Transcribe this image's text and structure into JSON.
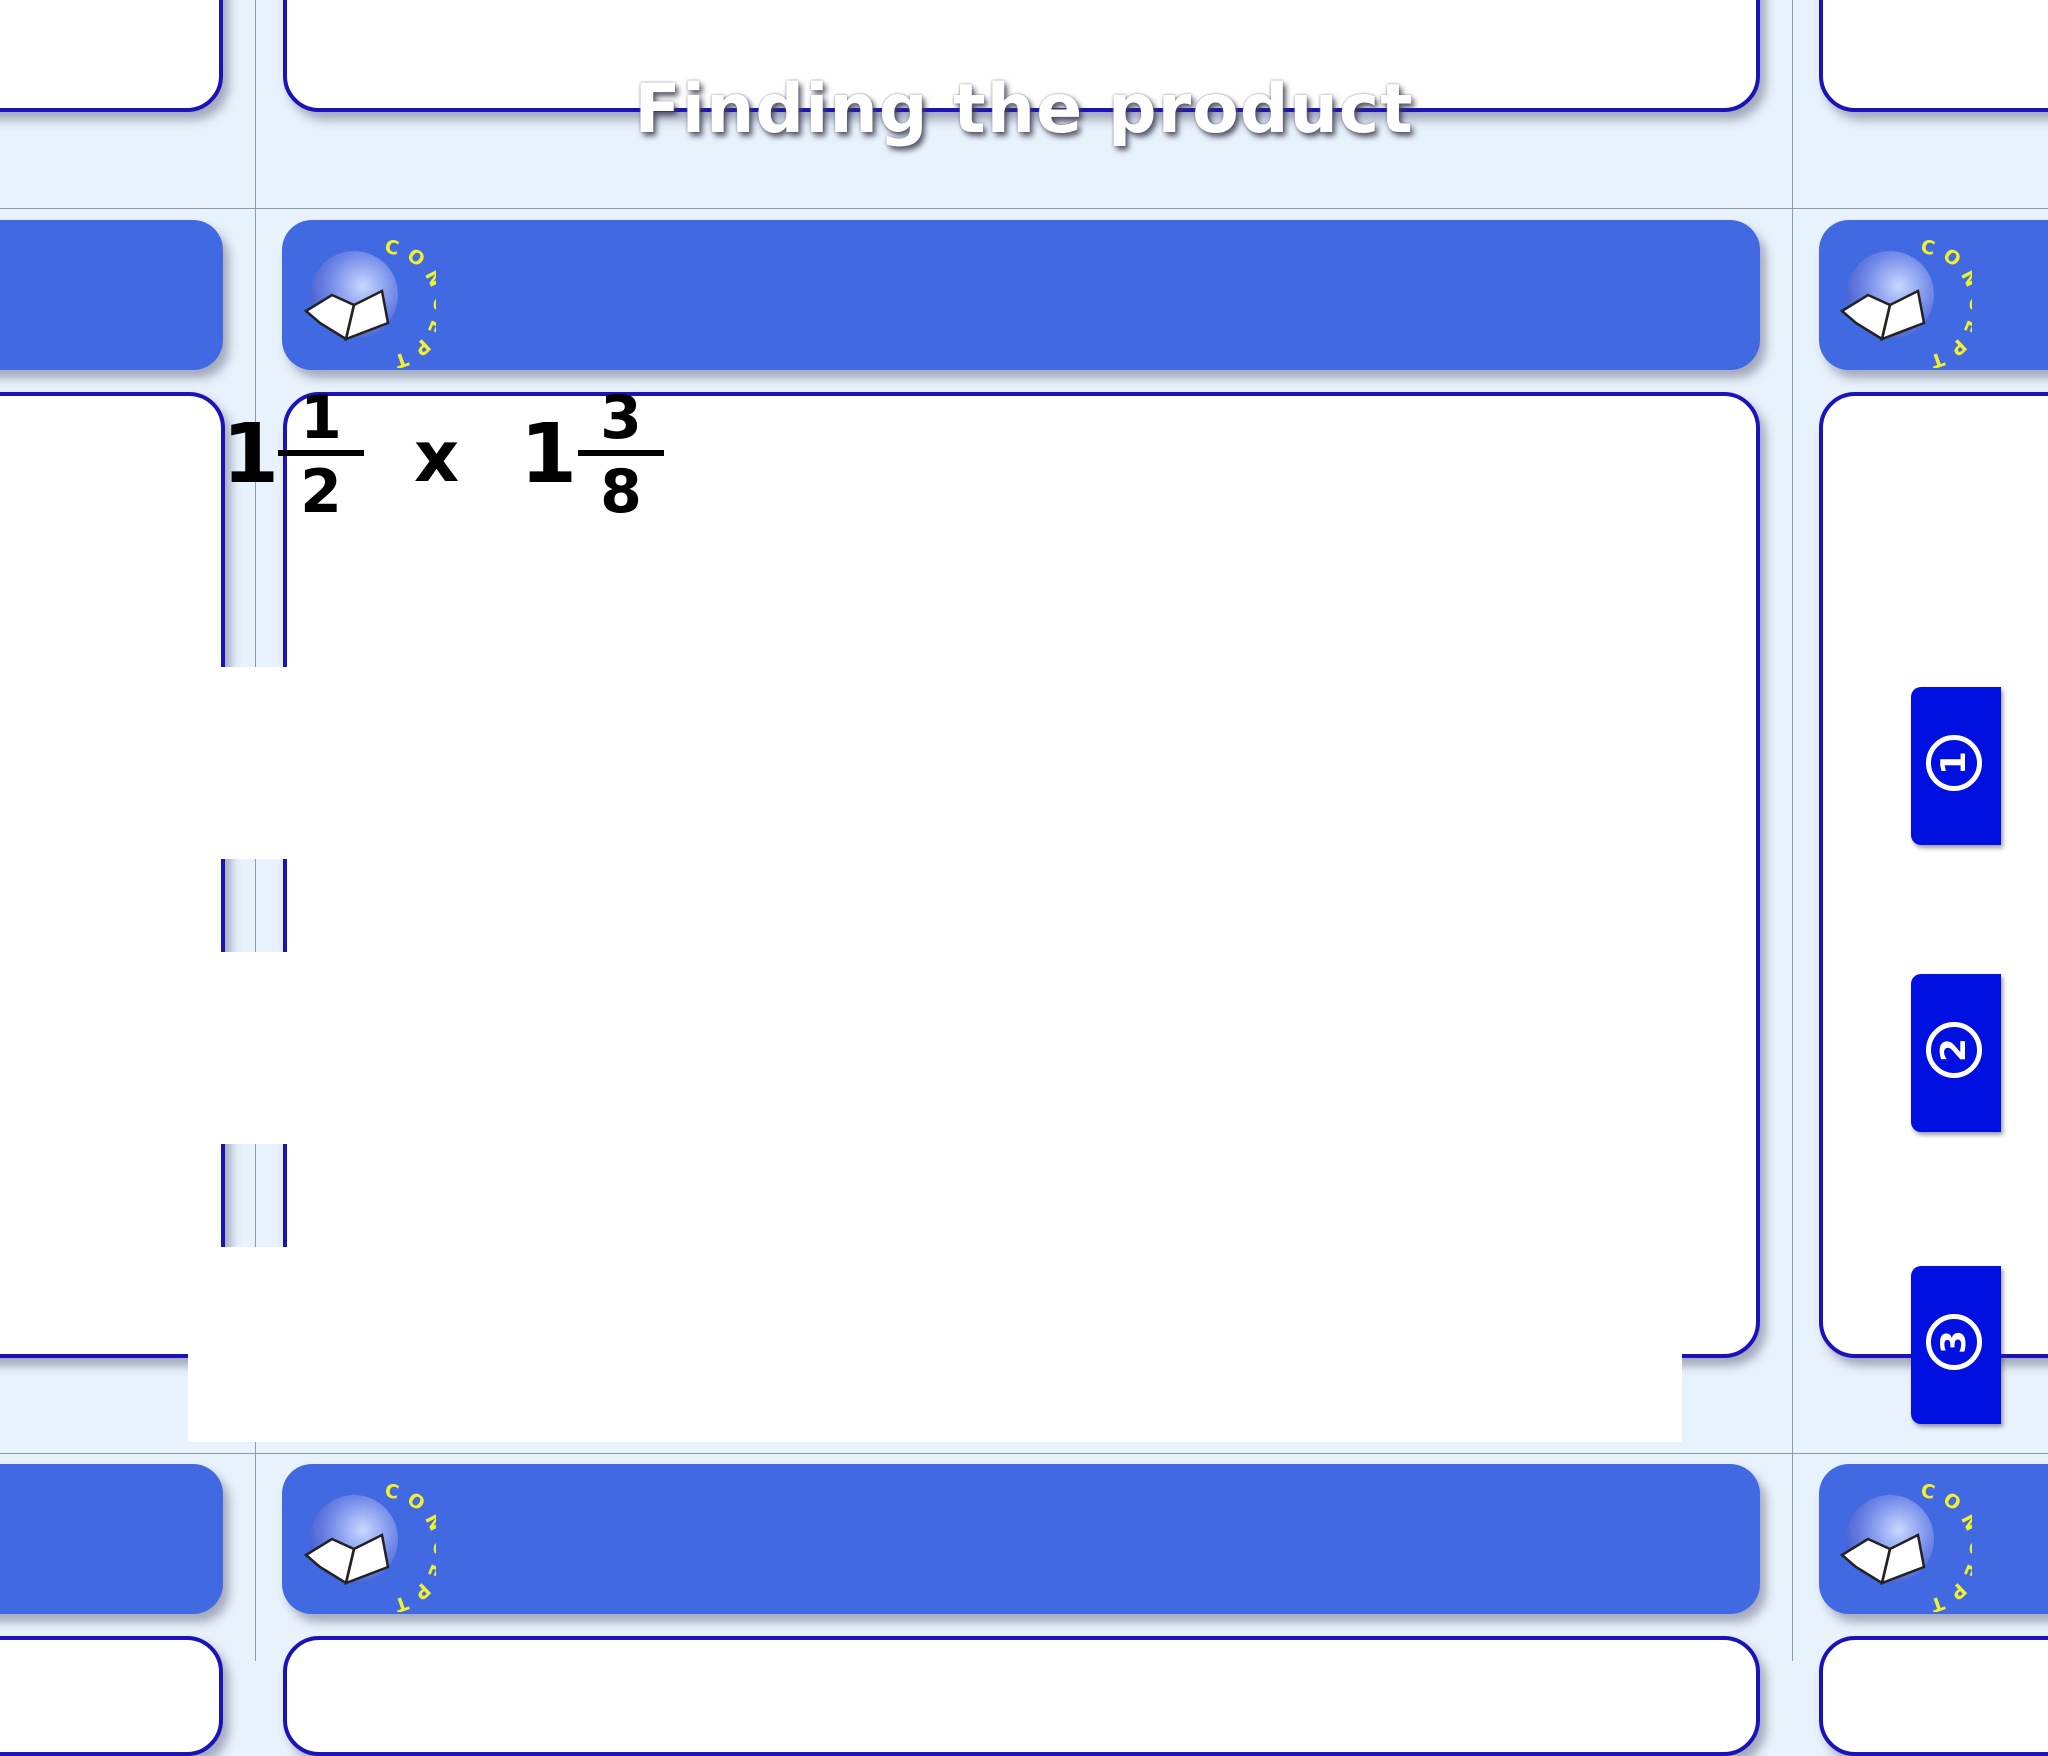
{
  "title": "Finding the product",
  "problem": {
    "first_whole": "1",
    "first_numerator": "1",
    "first_denominator": "2",
    "operator": "x",
    "second_whole": "1",
    "second_numerator": "3",
    "second_denominator": "8"
  },
  "steps": [
    {
      "label": "1"
    },
    {
      "label": "2"
    },
    {
      "label": "3"
    }
  ],
  "badge": {
    "label": "CONCEPT",
    "label_color": "#f0f030",
    "icon": "open-book-icon"
  },
  "colors": {
    "band": "#4169e1",
    "card_border": "#1a14b8",
    "step_tab": "#0010e0",
    "background": "#e8f2fc"
  }
}
